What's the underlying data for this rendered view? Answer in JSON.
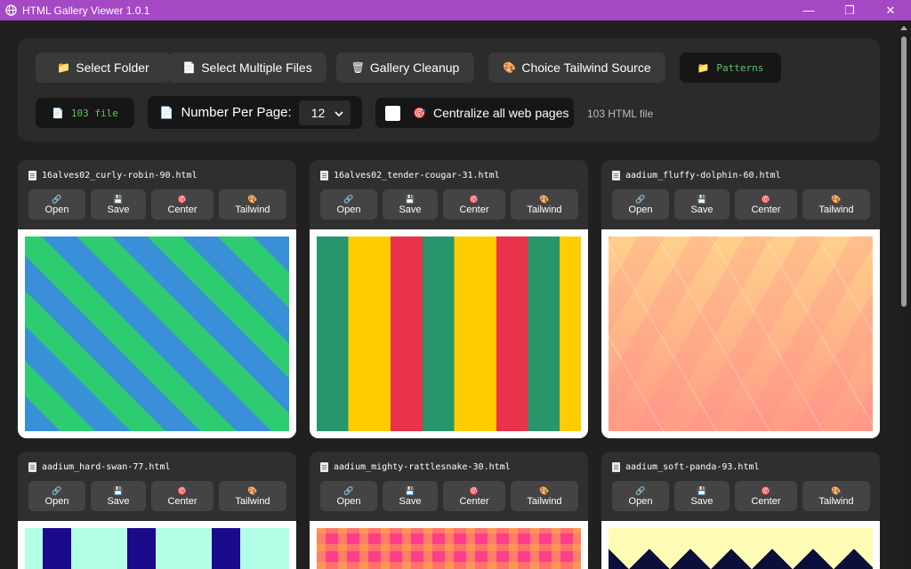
{
  "window": {
    "title": "HTML Gallery Viewer 1.0.1",
    "controls": {
      "minimize": "—",
      "restore": "❐",
      "close": "✕"
    }
  },
  "toolbar": {
    "select_folder": {
      "icon": "folder-icon",
      "label": "Select Folder"
    },
    "select_multiple": {
      "icon": "document-icon",
      "label": "Select Multiple Files"
    },
    "cleanup": {
      "icon": "trash-icon",
      "label": "Gallery Cleanup"
    },
    "tailwind_source": {
      "icon": "palette-icon",
      "label": "Choice Tailwind Source"
    },
    "patterns": {
      "icon": "folder-icon",
      "label": "Patterns"
    },
    "file_badge": {
      "icon": "document-icon",
      "label": "103 file"
    },
    "per_page": {
      "icon": "document-icon",
      "label": "Number Per Page:",
      "value": "12"
    },
    "centralize": {
      "icon": "target-icon",
      "label": "Centralize all web pages",
      "checked": false
    },
    "html_count": "103 HTML file"
  },
  "card_actions": {
    "open": "Open",
    "save": "Save",
    "center": "Center",
    "tailwind": "Tailwind"
  },
  "cards": [
    {
      "filename": "16alves02_curly-robin-90.html",
      "pattern": "diagonal-stripes",
      "colors": [
        "#3a8fd9",
        "#2ecc71"
      ]
    },
    {
      "filename": "16alves02_tender-cougar-31.html",
      "pattern": "vertical-stripes",
      "colors": [
        "#28956a",
        "#ffcc00",
        "#e8334a"
      ]
    },
    {
      "filename": "aadium_fluffy-dolphin-60.html",
      "pattern": "triangles",
      "colors": [
        "#ffd08a",
        "#ff9b86"
      ]
    },
    {
      "filename": "aadium_hard-swan-77.html",
      "pattern": "zigzag",
      "colors": [
        "#b3ffe8",
        "#1a0a8c"
      ]
    },
    {
      "filename": "aadium_mighty-rattlesnake-30.html",
      "pattern": "plaid",
      "colors": [
        "#ff3d8b",
        "#ffb347"
      ]
    },
    {
      "filename": "aadium_soft-panda-93.html",
      "pattern": "checker-triangles",
      "colors": [
        "#fffcb5",
        "#0b0f3a"
      ]
    }
  ],
  "colors": {
    "titlebar": "#a548c4",
    "background": "#202020",
    "panel": "#2b2b2b",
    "card": "#2f2f2f",
    "accent_green": "#5ec46a"
  }
}
